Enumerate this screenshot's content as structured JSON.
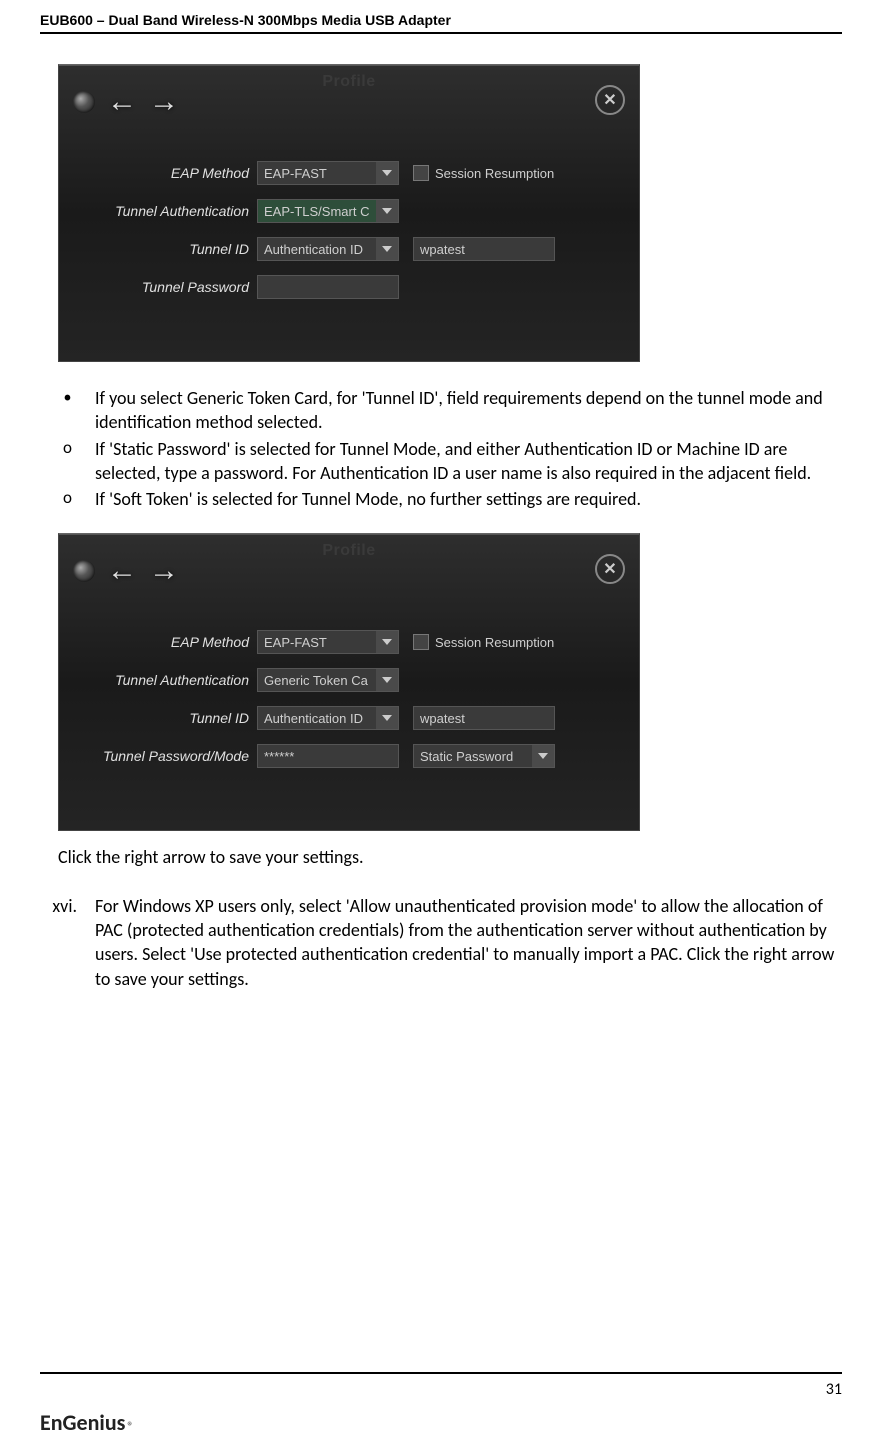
{
  "header": "EUB600 – Dual Band Wireless-N 300Mbps Media USB Adapter",
  "panel1": {
    "title": "Profile",
    "rows": {
      "eap_label": "EAP Method",
      "eap_value": "EAP-FAST",
      "session_label": "Session Resumption",
      "tunnel_auth_label": "Tunnel Authentication",
      "tunnel_auth_value": "EAP-TLS/Smart C",
      "tunnel_id_label": "Tunnel ID",
      "tunnel_id_sel": "Authentication ID",
      "tunnel_id_txt": "wpatest",
      "tunnel_pw_label": "Tunnel Password"
    }
  },
  "bullets": {
    "b1": "If you select Generic Token Card, for 'Tunnel ID', field requirements depend on the tunnel mode and identification method selected.",
    "o1": "If 'Static Password' is selected for Tunnel Mode, and either Authentication ID or Machine ID are selected, type a password. For Authentication ID a user name is also required in the adjacent field.",
    "o2": "If 'Soft Token' is selected for Tunnel Mode, no further settings are required."
  },
  "panel2": {
    "title": "Profile",
    "rows": {
      "eap_label": "EAP Method",
      "eap_value": "EAP-FAST",
      "session_label": "Session Resumption",
      "tunnel_auth_label": "Tunnel Authentication",
      "tunnel_auth_value": "Generic Token Ca",
      "tunnel_id_label": "Tunnel ID",
      "tunnel_id_sel": "Authentication ID",
      "tunnel_id_txt": "wpatest",
      "tunnel_pm_label": "Tunnel Password/Mode",
      "tunnel_pm_txt": "******",
      "tunnel_pm_sel": "Static Password"
    }
  },
  "after_panel": "Click the right arrow to save your settings.",
  "step": {
    "marker": "xvi.",
    "text": "For Windows XP users only, select 'Allow unauthenticated provision mode' to allow the allocation of PAC (protected authentication credentials) from the authentication server without authentication by users. Select 'Use protected authentication credential' to manually import a PAC. Click the right arrow to save your settings."
  },
  "page_number": "31",
  "logo": {
    "brand": "EnGenius",
    "reg": "®"
  }
}
